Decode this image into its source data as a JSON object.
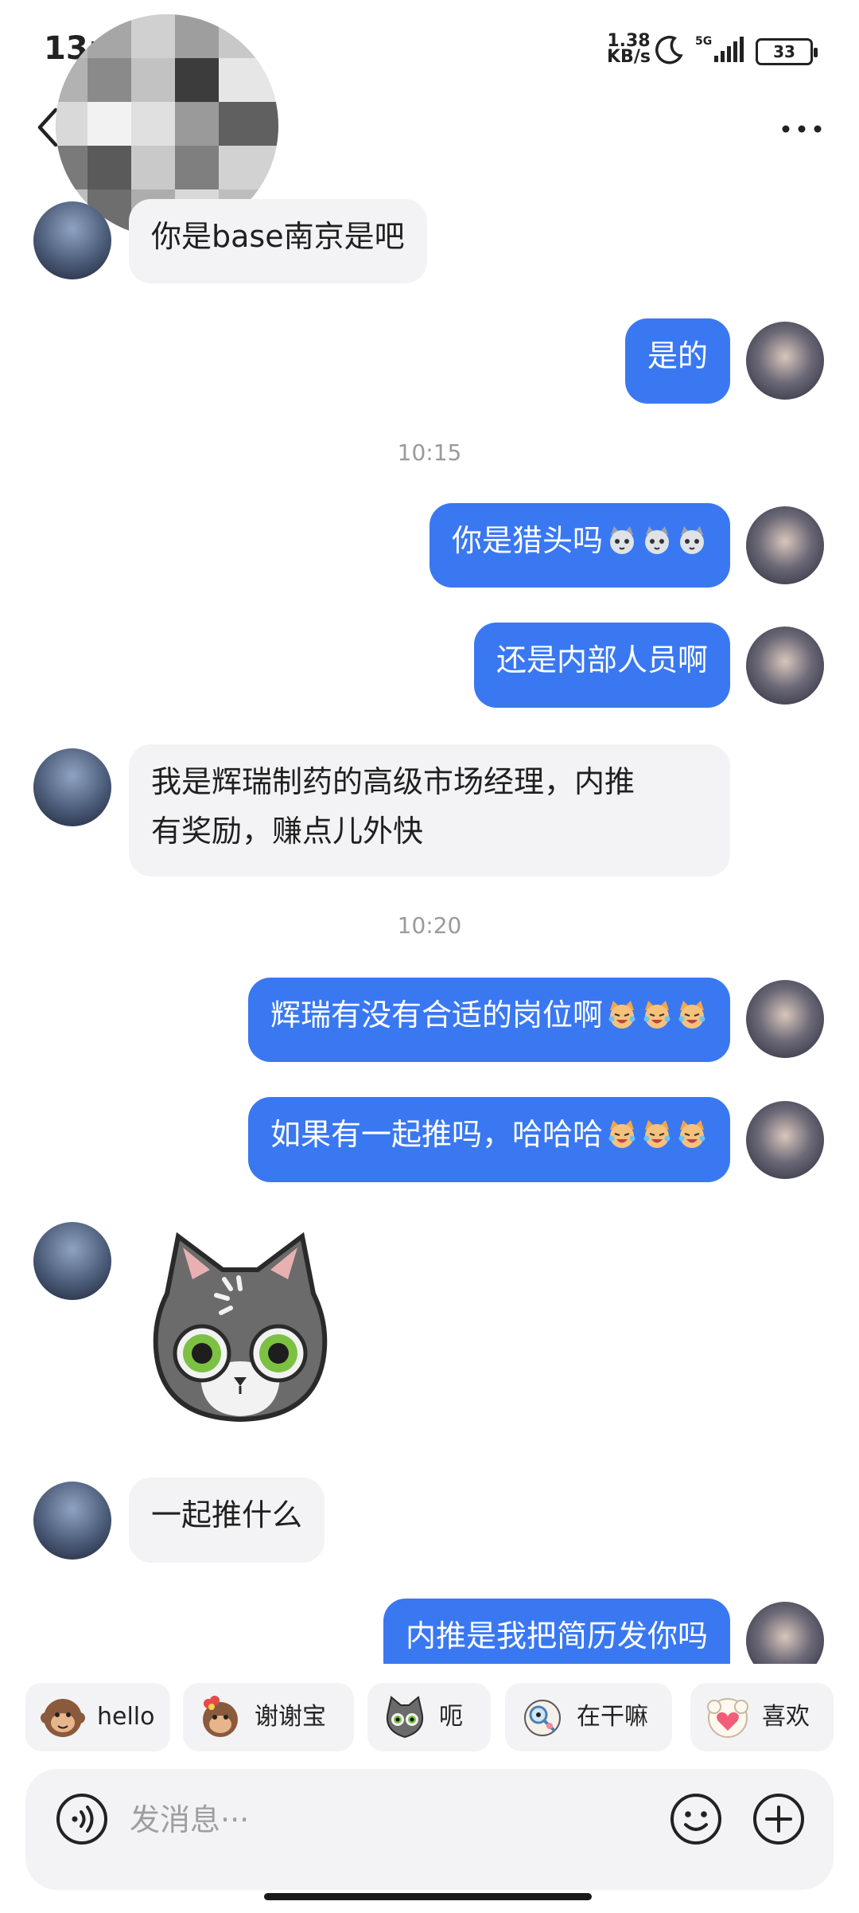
{
  "status_bar": {
    "time": "13:0",
    "net_speed_value": "1.38",
    "net_speed_unit": "KB/s",
    "network": "5G",
    "battery": "33"
  },
  "messages": [
    {
      "side": "recv",
      "text": "你是base南京是吧"
    },
    {
      "side": "sent",
      "text": "是的"
    },
    {
      "timestamp": "10:15"
    },
    {
      "side": "sent",
      "text": "你是猎头吗"
    },
    {
      "side": "sent",
      "text": "还是内部人员啊"
    },
    {
      "side": "recv",
      "text_line1": "我是辉瑞制药的高级市场经理，内推",
      "text_line2": "有奖励，赚点儿外快"
    },
    {
      "timestamp": "10:20"
    },
    {
      "side": "sent",
      "text": "辉瑞有没有合适的岗位啊"
    },
    {
      "side": "sent",
      "text": "如果有一起推吗，哈哈哈"
    },
    {
      "side": "recv",
      "sticker": "gray-cat-sticker"
    },
    {
      "side": "recv",
      "text": "一起推什么"
    },
    {
      "side": "sent",
      "text": "内推是我把简历发你吗"
    }
  ],
  "quick_replies": [
    {
      "label": "hello",
      "icon": "monkey-icon"
    },
    {
      "label": "谢谢宝",
      "icon": "monkey-flower-icon"
    },
    {
      "label": "呃",
      "icon": "cat-icon"
    },
    {
      "label": "在干嘛",
      "icon": "magnifier-character-icon"
    },
    {
      "label": "喜欢",
      "icon": "sheep-heart-icon"
    }
  ],
  "input": {
    "placeholder": "发消息···"
  },
  "colors": {
    "sent_bubble": "#3a78f2",
    "recv_bubble": "#f3f3f5",
    "background": "#ffffff"
  }
}
